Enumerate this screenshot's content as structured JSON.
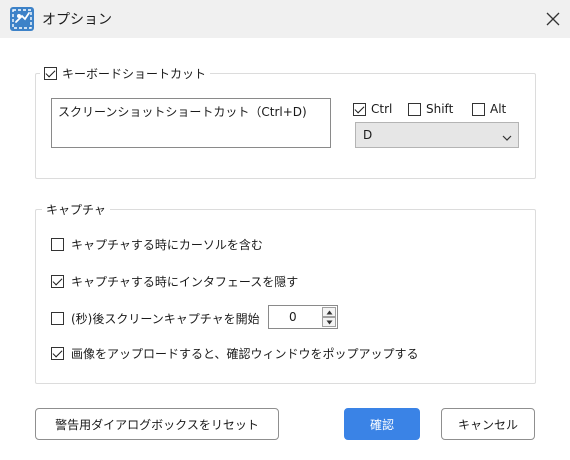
{
  "window": {
    "title": "オプション",
    "icons": {
      "app": "app-logo-icon",
      "close": "close-icon"
    }
  },
  "keyboard_group": {
    "label": "キーボードショートカット",
    "enabled": true,
    "shortcut_field_value": "スクリーンショットショートカット（Ctrl+D)",
    "modifiers": [
      {
        "label": "Ctrl",
        "checked": true
      },
      {
        "label": "Shift",
        "checked": false
      },
      {
        "label": "Alt",
        "checked": false
      }
    ],
    "key_select": {
      "value": "D",
      "icon": "chevron-down-icon"
    }
  },
  "capture_group": {
    "label": "キャプチャ",
    "options": [
      {
        "label": "キャプチャする時にカーソルを含む",
        "checked": false
      },
      {
        "label": "キャプチャする時にインタフェースを隠す",
        "checked": true
      },
      {
        "label": "(秒)後スクリーンキャプチャを開始",
        "checked": false
      },
      {
        "label": "画像をアップロードすると、確認ウィンドウをポップアップする",
        "checked": true
      }
    ],
    "delay_seconds": "0"
  },
  "footer": {
    "reset_label": "警告用ダイアログボックスをリセット",
    "ok_label": "確認",
    "cancel_label": "キャンセル"
  },
  "colors": {
    "primary": "#3a83e6",
    "titlebar": "#f0f0f0",
    "app_icon": "#3d82c8"
  }
}
